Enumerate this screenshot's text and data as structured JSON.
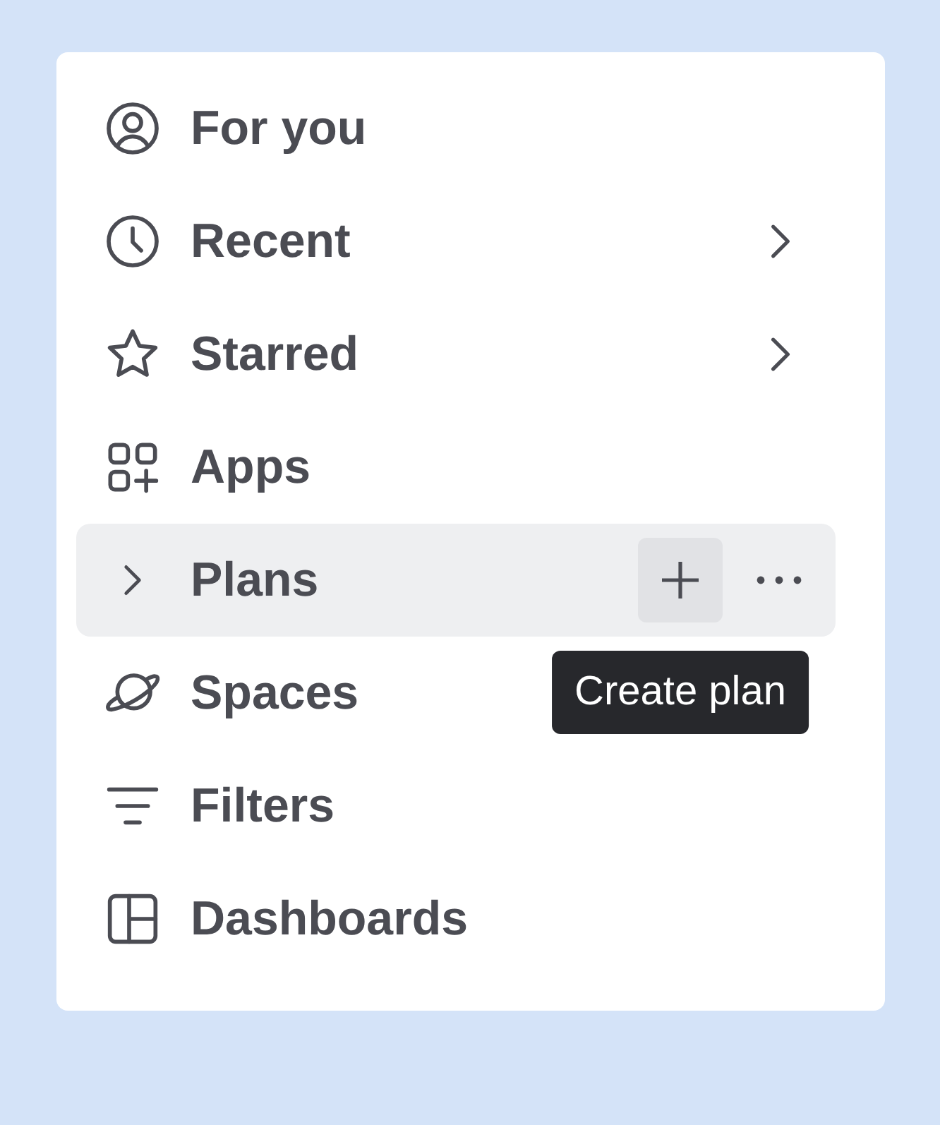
{
  "menu": {
    "items": [
      {
        "kind": "page",
        "label": "For you",
        "selected": false
      },
      {
        "kind": "flyout",
        "label": "Recent",
        "selected": false
      },
      {
        "kind": "flyout",
        "label": "Starred",
        "selected": false
      },
      {
        "kind": "page",
        "label": "Apps",
        "selected": false
      },
      {
        "kind": "section",
        "label": "Plans",
        "selected": true,
        "expanded": false,
        "add_button": {
          "hovered": true,
          "tooltip": "Create plan"
        }
      },
      {
        "kind": "page",
        "label": "Spaces",
        "selected": false
      },
      {
        "kind": "page",
        "label": "Filters",
        "selected": false
      },
      {
        "kind": "page",
        "label": "Dashboards",
        "selected": false
      }
    ]
  }
}
